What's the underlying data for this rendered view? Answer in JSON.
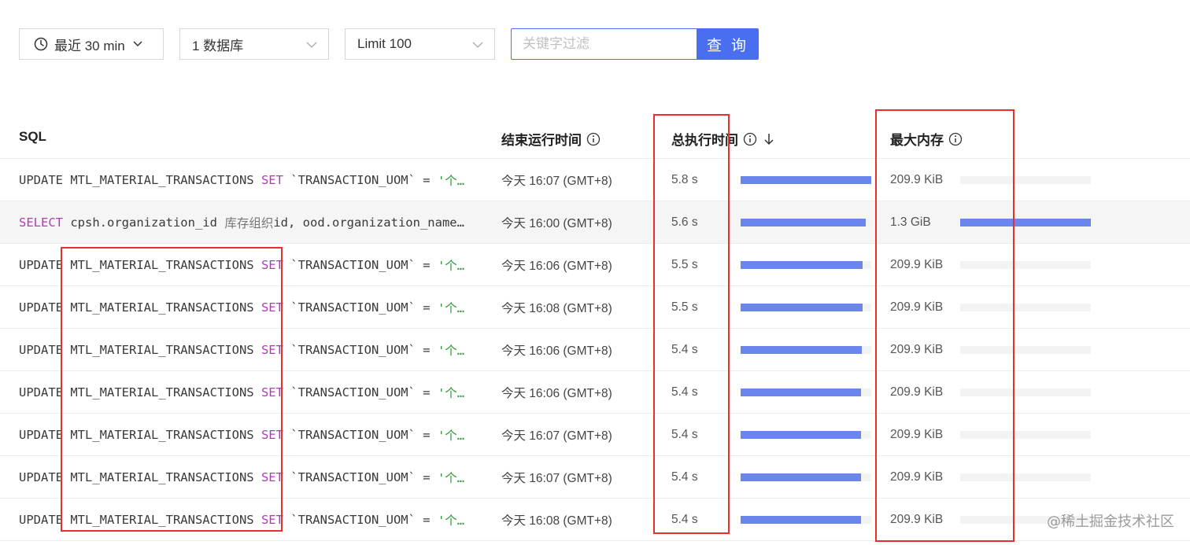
{
  "filters": {
    "time_range": "最近 30 min",
    "database": "1 数据库",
    "limit": "Limit 100"
  },
  "search": {
    "placeholder": "关键字过滤",
    "value": ""
  },
  "query_button": "查 询",
  "table": {
    "columns": {
      "sql": "SQL",
      "end_time": "结束运行时间",
      "total_time": "总执行时间",
      "max_memory": "最大内存"
    },
    "rows": [
      {
        "sql_parts": [
          [
            "UPDATE",
            ""
          ],
          [
            " MTL_MATERIAL_TRANSACTIONS ",
            ""
          ],
          [
            "SET",
            "kw"
          ],
          [
            " `TRANSACTION_UOM` = ",
            ""
          ],
          [
            "'个…",
            "str"
          ]
        ],
        "end_time": "今天 16:07 (GMT+8)",
        "total_time": "5.8 s",
        "duration_fraction": 1.0,
        "max_memory": "209.9 KiB",
        "memory_fraction": 0.0
      },
      {
        "sql_parts": [
          [
            "SELECT",
            "kw"
          ],
          [
            " cpsh.organization_id ",
            ""
          ],
          [
            "库存组织",
            "cjk"
          ],
          [
            "id, ood.organization_name…",
            ""
          ]
        ],
        "end_time": "今天 16:00 (GMT+8)",
        "total_time": "5.6 s",
        "duration_fraction": 0.957,
        "max_memory": "1.3 GiB",
        "memory_fraction": 1.0,
        "selected": true
      },
      {
        "sql_parts": [
          [
            "UPDATE",
            ""
          ],
          [
            " MTL_MATERIAL_TRANSACTIONS ",
            ""
          ],
          [
            "SET",
            "kw"
          ],
          [
            " `TRANSACTION_UOM` = ",
            ""
          ],
          [
            "'个…",
            "str"
          ]
        ],
        "end_time": "今天 16:06 (GMT+8)",
        "total_time": "5.5 s",
        "duration_fraction": 0.934,
        "max_memory": "209.9 KiB",
        "memory_fraction": 0.0
      },
      {
        "sql_parts": [
          [
            "UPDATE",
            ""
          ],
          [
            " MTL_MATERIAL_TRANSACTIONS ",
            ""
          ],
          [
            "SET",
            "kw"
          ],
          [
            " `TRANSACTION_UOM` = ",
            ""
          ],
          [
            "'个…",
            "str"
          ]
        ],
        "end_time": "今天 16:08 (GMT+8)",
        "total_time": "5.5 s",
        "duration_fraction": 0.934,
        "max_memory": "209.9 KiB",
        "memory_fraction": 0.0
      },
      {
        "sql_parts": [
          [
            "UPDATE",
            ""
          ],
          [
            " MTL_MATERIAL_TRANSACTIONS ",
            ""
          ],
          [
            "SET",
            "kw"
          ],
          [
            " `TRANSACTION_UOM` = ",
            ""
          ],
          [
            "'个…",
            "str"
          ]
        ],
        "end_time": "今天 16:06 (GMT+8)",
        "total_time": "5.4 s",
        "duration_fraction": 0.928,
        "max_memory": "209.9 KiB",
        "memory_fraction": 0.0
      },
      {
        "sql_parts": [
          [
            "UPDATE",
            ""
          ],
          [
            " MTL_MATERIAL_TRANSACTIONS ",
            ""
          ],
          [
            "SET",
            "kw"
          ],
          [
            " `TRANSACTION_UOM` = ",
            ""
          ],
          [
            "'个…",
            "str"
          ]
        ],
        "end_time": "今天 16:06 (GMT+8)",
        "total_time": "5.4 s",
        "duration_fraction": 0.922,
        "max_memory": "209.9 KiB",
        "memory_fraction": 0.0
      },
      {
        "sql_parts": [
          [
            "UPDATE",
            ""
          ],
          [
            " MTL_MATERIAL_TRANSACTIONS ",
            ""
          ],
          [
            "SET",
            "kw"
          ],
          [
            " `TRANSACTION_UOM` = ",
            ""
          ],
          [
            "'个…",
            "str"
          ]
        ],
        "end_time": "今天 16:07 (GMT+8)",
        "total_time": "5.4 s",
        "duration_fraction": 0.922,
        "max_memory": "209.9 KiB",
        "memory_fraction": 0.0
      },
      {
        "sql_parts": [
          [
            "UPDATE",
            ""
          ],
          [
            " MTL_MATERIAL_TRANSACTIONS ",
            ""
          ],
          [
            "SET",
            "kw"
          ],
          [
            " `TRANSACTION_UOM` = ",
            ""
          ],
          [
            "'个…",
            "str"
          ]
        ],
        "end_time": "今天 16:07 (GMT+8)",
        "total_time": "5.4 s",
        "duration_fraction": 0.922,
        "max_memory": "209.9 KiB",
        "memory_fraction": 0.0
      },
      {
        "sql_parts": [
          [
            "UPDATE",
            ""
          ],
          [
            " MTL_MATERIAL_TRANSACTIONS ",
            ""
          ],
          [
            "SET",
            "kw"
          ],
          [
            " `TRANSACTION_UOM` = ",
            ""
          ],
          [
            "'个…",
            "str"
          ]
        ],
        "end_time": "今天 16:08 (GMT+8)",
        "total_time": "5.4 s",
        "duration_fraction": 0.922,
        "max_memory": "209.9 KiB",
        "memory_fraction": 0.0
      }
    ]
  },
  "colors": {
    "accent": "#4a6ef0",
    "bar": "#6a86ec",
    "highlight_box": "#e5302f",
    "sql_keyword": "#b23bb5",
    "sql_string": "#2e9a3a"
  },
  "icons": [
    "clock-icon",
    "chevron-down-icon",
    "info-icon",
    "sort-desc-icon"
  ],
  "watermark": "@稀土掘金技术社区"
}
